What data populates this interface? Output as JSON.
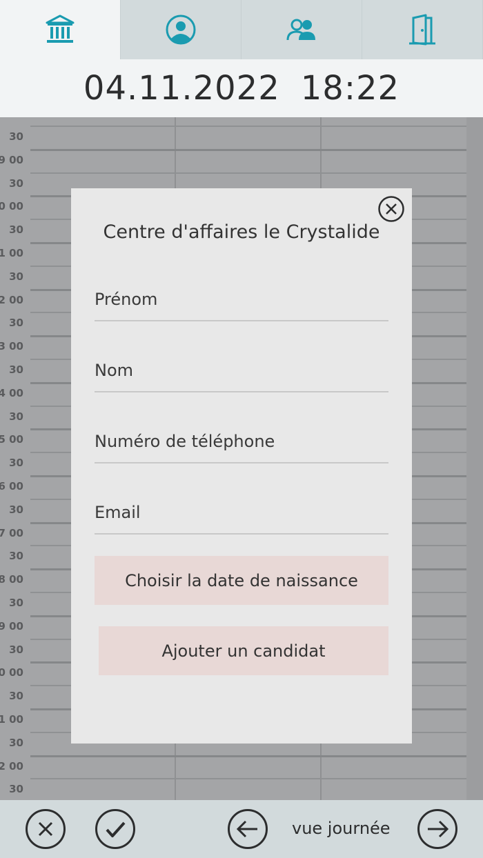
{
  "tabs": [
    {
      "icon": "bank-icon",
      "active": true
    },
    {
      "icon": "user-circle-icon",
      "active": false
    },
    {
      "icon": "users-icon",
      "active": false
    },
    {
      "icon": "door-exit-icon",
      "active": false
    }
  ],
  "header": {
    "date": "04.11.2022",
    "time": "18:22"
  },
  "calendar": {
    "time_labels": [
      "30",
      "9 00",
      "30",
      "0 00",
      "30",
      "1 00",
      "30",
      "2 00",
      "30",
      "3 00",
      "30",
      "4 00",
      "30",
      "5 00",
      "30",
      "6 00",
      "30",
      "7 00",
      "30",
      "8 00",
      "30",
      "9 00",
      "30",
      "0 00",
      "30",
      "1 00",
      "30",
      "2 00",
      "30"
    ]
  },
  "modal": {
    "title": "Centre d'affaires le Crystalide",
    "close_icon": "close-circle-icon",
    "fields": {
      "first_name": "Prénom",
      "last_name": "Nom",
      "phone": "Numéro de téléphone",
      "email": "Email"
    },
    "birthdate_button": "Choisir la date de naissance",
    "add_button": "Ajouter un candidat"
  },
  "bottom": {
    "cancel_icon": "close-circle-icon",
    "confirm_icon": "check-circle-icon",
    "prev_icon": "arrow-left-circle-icon",
    "next_icon": "arrow-right-circle-icon",
    "view_label": "vue journée"
  },
  "colors": {
    "accent": "#1a9bb0",
    "tabbar": "#d2dadc",
    "modal": "#e8e8e8",
    "button": "#e8d8d6"
  }
}
